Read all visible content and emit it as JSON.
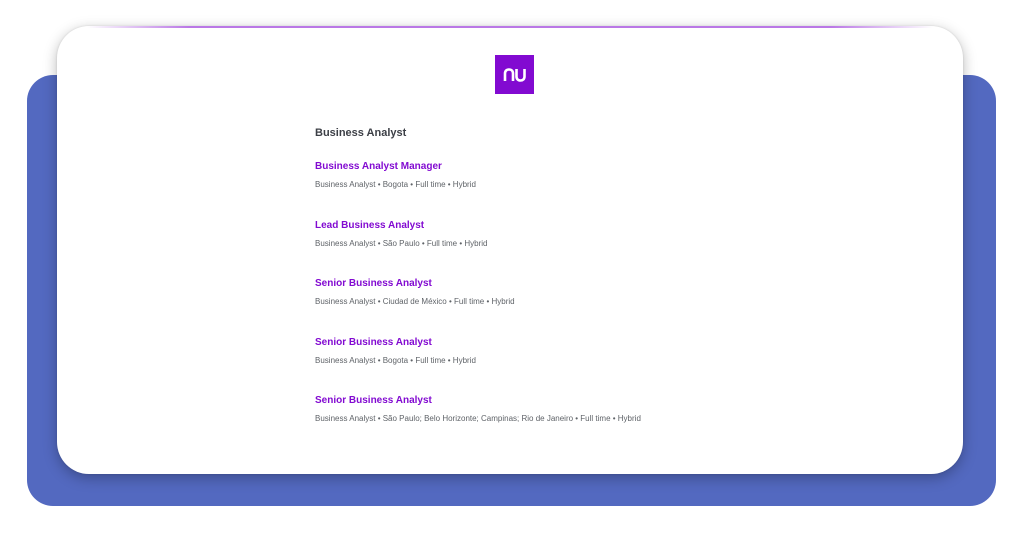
{
  "brand": {
    "logo_text": "nu",
    "color": "#820ad1"
  },
  "colors": {
    "backdrop": "#5369c0",
    "card": "#ffffff",
    "job_title": "#820ad1",
    "heading": "#3c3f46",
    "meta": "#5f6368"
  },
  "section": {
    "title": "Business Analyst"
  },
  "jobs": [
    {
      "title": "Business Analyst Manager",
      "meta": "Business Analyst • Bogota • Full time • Hybrid"
    },
    {
      "title": "Lead Business Analyst",
      "meta": "Business Analyst • São Paulo • Full time • Hybrid"
    },
    {
      "title": "Senior Business Analyst",
      "meta": "Business Analyst • Ciudad de México • Full time • Hybrid"
    },
    {
      "title": "Senior Business Analyst",
      "meta": "Business Analyst • Bogota • Full time • Hybrid"
    },
    {
      "title": "Senior Business Analyst",
      "meta": "Business Analyst • São Paulo; Belo Horizonte; Campinas; Rio de Janeiro • Full time • Hybrid"
    }
  ]
}
